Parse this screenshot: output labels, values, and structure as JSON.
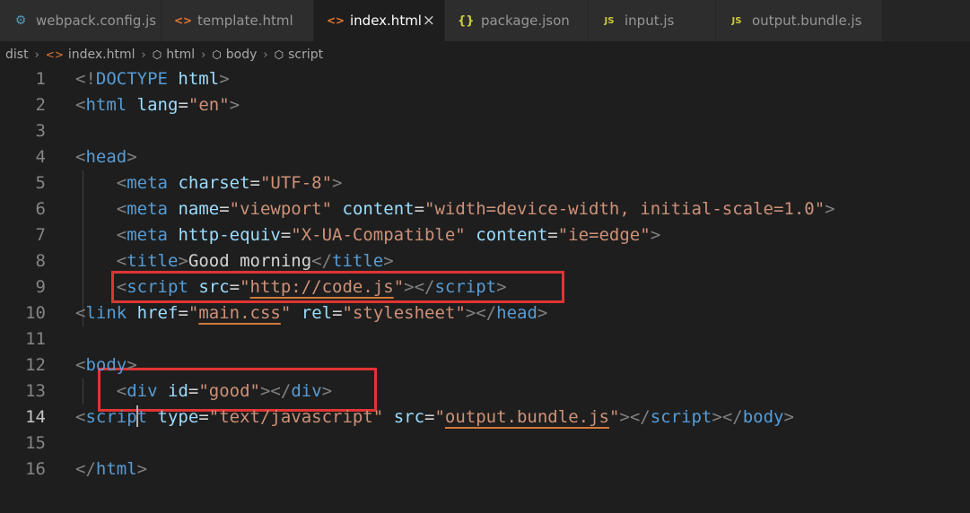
{
  "tabs": [
    {
      "icon": "gear-icon",
      "glyph": "⚙",
      "label": "webpack.config.js",
      "active": false
    },
    {
      "icon": "html-file-icon",
      "glyph": "<>",
      "label": "template.html",
      "active": false
    },
    {
      "icon": "html-file-icon",
      "glyph": "<>",
      "label": "index.html",
      "active": true,
      "close": "×"
    },
    {
      "icon": "json-file-icon",
      "glyph": "{}",
      "label": "package.json",
      "active": false
    },
    {
      "icon": "js-file-icon",
      "glyph": "JS",
      "label": "input.js",
      "active": false
    },
    {
      "icon": "js-file-icon",
      "glyph": "JS",
      "label": "output.bundle.js",
      "active": false
    }
  ],
  "breadcrumb": [
    {
      "label": "dist",
      "icon": ""
    },
    {
      "label": "index.html",
      "icon": "<>"
    },
    {
      "label": "html",
      "icon": "⬡"
    },
    {
      "label": "body",
      "icon": "⬡"
    },
    {
      "label": "script",
      "icon": "⬡"
    }
  ],
  "breadcrumb_separator": "›",
  "current_line": 14,
  "lines": [
    {
      "num": "1",
      "t": [
        [
          "t",
          "<!"
        ],
        [
          "n",
          "DOCTYPE"
        ],
        [
          "x",
          " "
        ],
        [
          "a",
          "html"
        ],
        [
          "t",
          ">"
        ]
      ]
    },
    {
      "num": "2",
      "t": [
        [
          "t",
          "<"
        ],
        [
          "n",
          "html"
        ],
        [
          "x",
          " "
        ],
        [
          "a",
          "lang"
        ],
        [
          "x",
          "="
        ],
        [
          "s",
          "\"en\""
        ],
        [
          "t",
          ">"
        ]
      ]
    },
    {
      "num": "3",
      "t": []
    },
    {
      "num": "4",
      "t": [
        [
          "t",
          "<"
        ],
        [
          "n",
          "head"
        ],
        [
          "t",
          ">"
        ]
      ]
    },
    {
      "num": "5",
      "t": [
        [
          "x",
          "    "
        ],
        [
          "t",
          "<"
        ],
        [
          "n",
          "meta"
        ],
        [
          "x",
          " "
        ],
        [
          "a",
          "charset"
        ],
        [
          "x",
          "="
        ],
        [
          "s",
          "\"UTF-8\""
        ],
        [
          "t",
          ">"
        ]
      ]
    },
    {
      "num": "6",
      "t": [
        [
          "x",
          "    "
        ],
        [
          "t",
          "<"
        ],
        [
          "n",
          "meta"
        ],
        [
          "x",
          " "
        ],
        [
          "a",
          "name"
        ],
        [
          "x",
          "="
        ],
        [
          "s",
          "\"viewport\""
        ],
        [
          "x",
          " "
        ],
        [
          "a",
          "content"
        ],
        [
          "x",
          "="
        ],
        [
          "s",
          "\"width=device-width, initial-scale=1.0\""
        ],
        [
          "t",
          ">"
        ]
      ]
    },
    {
      "num": "7",
      "t": [
        [
          "x",
          "    "
        ],
        [
          "t",
          "<"
        ],
        [
          "n",
          "meta"
        ],
        [
          "x",
          " "
        ],
        [
          "a",
          "http-equiv"
        ],
        [
          "x",
          "="
        ],
        [
          "s",
          "\"X-UA-Compatible\""
        ],
        [
          "x",
          " "
        ],
        [
          "a",
          "content"
        ],
        [
          "x",
          "="
        ],
        [
          "s",
          "\"ie=edge\""
        ],
        [
          "t",
          ">"
        ]
      ]
    },
    {
      "num": "8",
      "t": [
        [
          "x",
          "    "
        ],
        [
          "t",
          "<"
        ],
        [
          "n",
          "title"
        ],
        [
          "t",
          ">"
        ],
        [
          "x",
          "Good morning"
        ],
        [
          "t",
          "</"
        ],
        [
          "n",
          "title"
        ],
        [
          "t",
          ">"
        ]
      ]
    },
    {
      "num": "9",
      "t": [
        [
          "x",
          "    "
        ],
        [
          "t",
          "<"
        ],
        [
          "n",
          "script"
        ],
        [
          "x",
          " "
        ],
        [
          "a",
          "src"
        ],
        [
          "x",
          "="
        ],
        [
          "s",
          "\""
        ],
        [
          "su",
          "http://code.js"
        ],
        [
          "s",
          "\""
        ],
        [
          "t",
          "></"
        ],
        [
          "n",
          "script"
        ],
        [
          "t",
          ">"
        ]
      ]
    },
    {
      "num": "10",
      "t": [
        [
          "t",
          "<"
        ],
        [
          "n",
          "link"
        ],
        [
          "x",
          " "
        ],
        [
          "a",
          "href"
        ],
        [
          "x",
          "="
        ],
        [
          "s",
          "\""
        ],
        [
          "su",
          "main.css"
        ],
        [
          "s",
          "\""
        ],
        [
          "x",
          " "
        ],
        [
          "a",
          "rel"
        ],
        [
          "x",
          "="
        ],
        [
          "s",
          "\"stylesheet\""
        ],
        [
          "t",
          "></"
        ],
        [
          "n",
          "head"
        ],
        [
          "t",
          ">"
        ]
      ]
    },
    {
      "num": "11",
      "t": []
    },
    {
      "num": "12",
      "t": [
        [
          "t",
          "<"
        ],
        [
          "n",
          "body"
        ],
        [
          "t",
          ">"
        ]
      ]
    },
    {
      "num": "13",
      "t": [
        [
          "x",
          "    "
        ],
        [
          "t",
          "<"
        ],
        [
          "n",
          "div"
        ],
        [
          "x",
          " "
        ],
        [
          "a",
          "id"
        ],
        [
          "x",
          "="
        ],
        [
          "s",
          "\"good\""
        ],
        [
          "t",
          "></"
        ],
        [
          "n",
          "div"
        ],
        [
          "t",
          ">"
        ]
      ]
    },
    {
      "num": "14",
      "t": [
        [
          "t",
          "<"
        ],
        [
          "n",
          "script"
        ],
        [
          "x",
          " "
        ],
        [
          "a",
          "type"
        ],
        [
          "x",
          "="
        ],
        [
          "s",
          "\"text/javascript\""
        ],
        [
          "x",
          " "
        ],
        [
          "a",
          "src"
        ],
        [
          "x",
          "="
        ],
        [
          "s",
          "\""
        ],
        [
          "su",
          "output.bundle.js"
        ],
        [
          "s",
          "\""
        ],
        [
          "t",
          "></"
        ],
        [
          "n",
          "script"
        ],
        [
          "t",
          "></"
        ],
        [
          "n",
          "body"
        ],
        [
          "t",
          ">"
        ]
      ]
    },
    {
      "num": "15",
      "t": []
    },
    {
      "num": "16",
      "t": [
        [
          "t",
          "</"
        ],
        [
          "n",
          "html"
        ],
        [
          "t",
          ">"
        ]
      ]
    }
  ],
  "colors": {
    "background": "#1e1e1e",
    "tag_bracket": "#808080",
    "tag_name": "#569cd6",
    "attribute": "#9cdcfe",
    "string": "#ce9178",
    "text": "#d4d4d4",
    "highlight_box": "#e03434"
  }
}
